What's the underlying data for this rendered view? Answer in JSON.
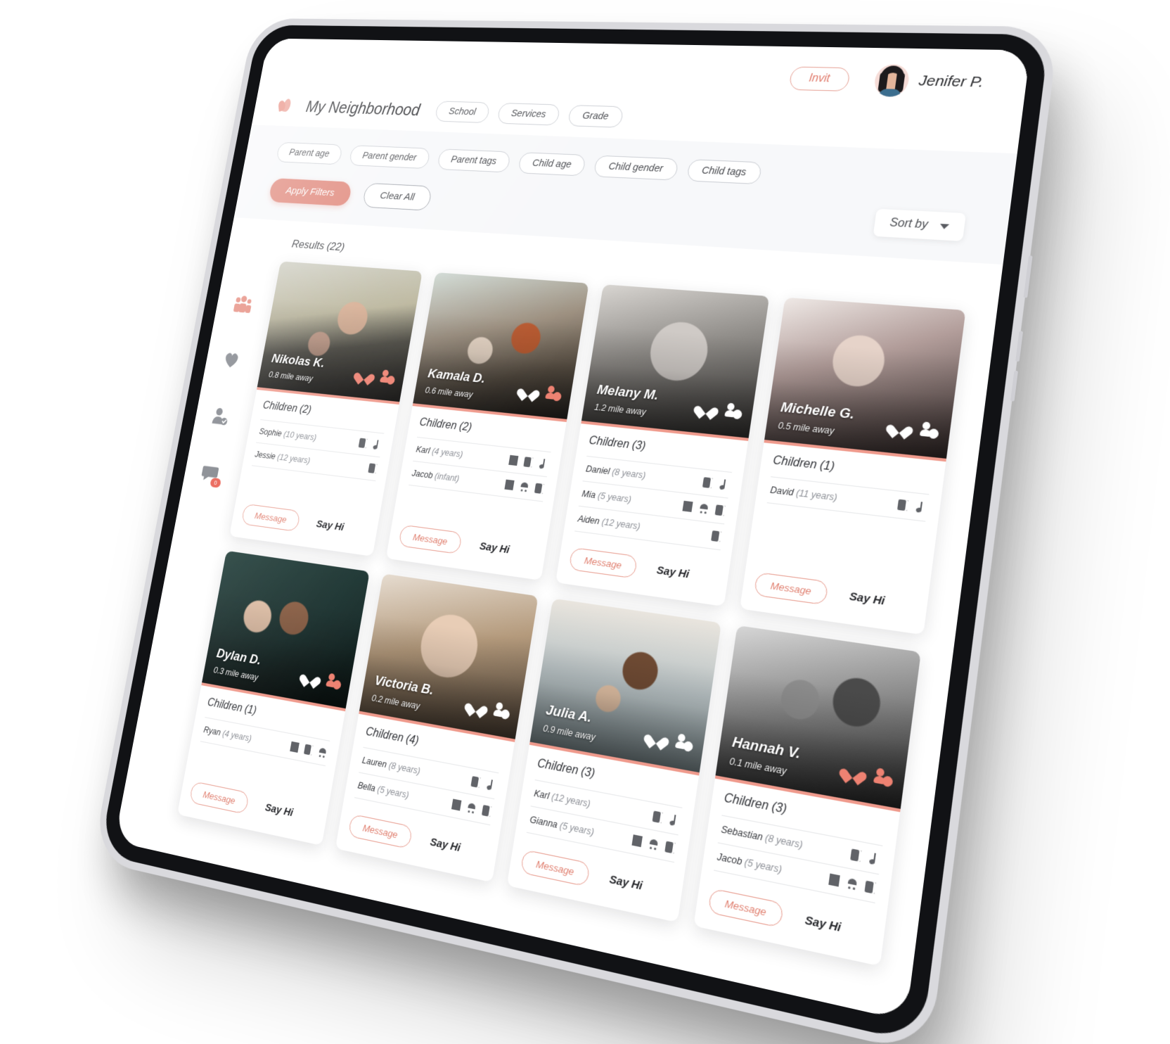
{
  "app": {
    "page_title": "My Neighborhood",
    "logo_icon": "bird-logo-icon"
  },
  "topbar": {
    "invite_label": "Invit",
    "user_name": "Jenifer P.",
    "avatar_icon": "user-avatar"
  },
  "header_pills": [
    {
      "label": "School"
    },
    {
      "label": "Services"
    },
    {
      "label": "Grade"
    }
  ],
  "filters": {
    "pills": [
      {
        "label": "Parent age"
      },
      {
        "label": "Parent gender"
      },
      {
        "label": "Parent tags"
      },
      {
        "label": "Child age"
      },
      {
        "label": "Child gender"
      },
      {
        "label": "Child tags"
      }
    ],
    "apply_label": "Apply Filters",
    "clear_label": "Clear All",
    "sort_label": "Sort by",
    "sort_icon": "chevron-down-icon"
  },
  "sidebar": {
    "items": [
      {
        "icon": "family-group-icon",
        "active": true
      },
      {
        "icon": "heart-icon",
        "active": false
      },
      {
        "icon": "person-check-icon",
        "active": false
      },
      {
        "icon": "chat-bubble-icon",
        "active": false,
        "badge": "0"
      }
    ]
  },
  "results": {
    "count_label": "Results (22)",
    "message_label": "Message",
    "say_hi_label": "Say Hi",
    "children_label_prefix": "Children",
    "cards": [
      {
        "name": "Nikolas K.",
        "distance": "0.8 mile away",
        "photo": "p-nikolas",
        "liked": true,
        "add_highlight": true,
        "children_title": "Children (2)",
        "children": [
          {
            "name": "Sophie",
            "age": "(10 years)",
            "tags": [
              "book",
              "music"
            ]
          },
          {
            "name": "Jessie",
            "age": "(12 years)",
            "tags": [
              "book"
            ]
          }
        ]
      },
      {
        "name": "Kamala D.",
        "distance": "0.6 mile away",
        "photo": "p-kamala",
        "liked": false,
        "add_highlight": true,
        "children_title": "Children (2)",
        "children": [
          {
            "name": "Karl",
            "age": "(4 years)",
            "tags": [
              "horse",
              "book",
              "music"
            ]
          },
          {
            "name": "Jacob",
            "age": "(infant)",
            "tags": [
              "horse",
              "stroller",
              "book"
            ]
          }
        ]
      },
      {
        "name": "Melany M.",
        "distance": "1.2 mile away",
        "photo": "p-melany",
        "liked": false,
        "add_highlight": false,
        "children_title": "Children (3)",
        "children": [
          {
            "name": "Daniel",
            "age": "(8 years)",
            "tags": [
              "book",
              "music"
            ]
          },
          {
            "name": "Mia",
            "age": "(5 years)",
            "tags": [
              "horse",
              "stroller",
              "book"
            ]
          },
          {
            "name": "Aiden",
            "age": "(12 years)",
            "tags": [
              "book"
            ]
          }
        ]
      },
      {
        "name": "Michelle G.",
        "distance": "0.5 mile away",
        "photo": "p-michelle",
        "liked": false,
        "add_highlight": false,
        "children_title": "Children (1)",
        "children": [
          {
            "name": "David",
            "age": "(11 years)",
            "tags": [
              "book",
              "music"
            ]
          }
        ]
      },
      {
        "name": "Dylan D.",
        "distance": "0.3 mile away",
        "photo": "p-dylan",
        "liked": false,
        "add_highlight": true,
        "children_title": "Children (1)",
        "children": [
          {
            "name": "Ryan",
            "age": "(4 years)",
            "tags": [
              "horse",
              "book",
              "stroller"
            ]
          }
        ]
      },
      {
        "name": "Victoria B.",
        "distance": "0.2 mile away",
        "photo": "p-victoria",
        "liked": false,
        "add_highlight": false,
        "children_title": "Children (4)",
        "children": [
          {
            "name": "Lauren",
            "age": "(8 years)",
            "tags": [
              "book",
              "music"
            ]
          },
          {
            "name": "Bella",
            "age": "(5 years)",
            "tags": [
              "horse",
              "stroller",
              "book"
            ]
          }
        ]
      },
      {
        "name": "Julia A.",
        "distance": "0.9 mile away",
        "photo": "p-julia",
        "liked": false,
        "add_highlight": false,
        "children_title": "Children (3)",
        "children": [
          {
            "name": "Karl",
            "age": "(12 years)",
            "tags": [
              "book",
              "music"
            ]
          },
          {
            "name": "Gianna",
            "age": "(5 years)",
            "tags": [
              "horse",
              "stroller",
              "book"
            ]
          }
        ]
      },
      {
        "name": "Hannah V.",
        "distance": "0.1 mile away",
        "photo": "p-hannah",
        "liked": true,
        "add_highlight": true,
        "children_title": "Children (3)",
        "children": [
          {
            "name": "Sebastian",
            "age": "(8 years)",
            "tags": [
              "book",
              "music"
            ]
          },
          {
            "name": "Jacob",
            "age": "(5 years)",
            "tags": [
              "horse",
              "stroller",
              "book"
            ]
          }
        ]
      }
    ]
  },
  "colors": {
    "accent": "#e8897c",
    "accent_strong": "#df8477",
    "panel_bg": "#f7f8fa"
  }
}
